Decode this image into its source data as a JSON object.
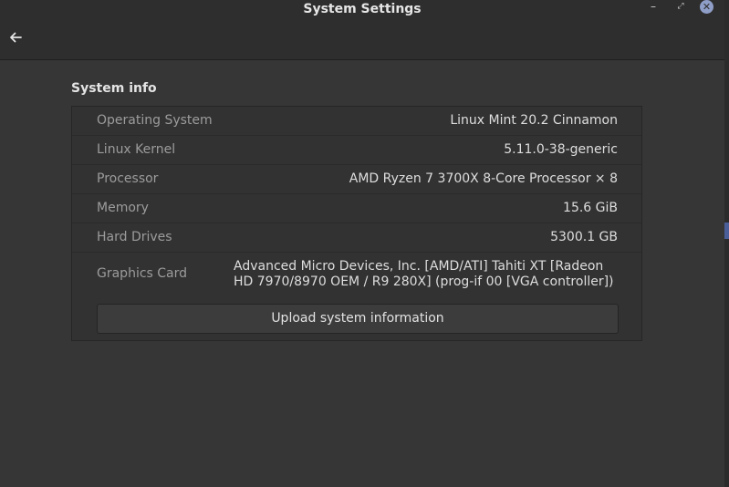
{
  "window": {
    "title": "System Settings",
    "controls": {
      "minimize": "–",
      "maximize": "⤢",
      "close": "✕"
    },
    "back_icon": "arrow-left-icon"
  },
  "section": {
    "title": "System info"
  },
  "rows": [
    {
      "label": "Operating System",
      "value": "Linux Mint 20.2 Cinnamon"
    },
    {
      "label": "Linux Kernel",
      "value": "5.11.0-38-generic"
    },
    {
      "label": "Processor",
      "value": "AMD Ryzen 7 3700X 8-Core Processor × 8"
    },
    {
      "label": "Memory",
      "value": "15.6 GiB"
    },
    {
      "label": "Hard Drives",
      "value": "5300.1 GB"
    },
    {
      "label": "Graphics Card",
      "value": "Advanced Micro Devices, Inc. [AMD/ATI] Tahiti XT [Radeon HD 7970/8970 OEM / R9 280X] (prog-if 00 [VGA controller])"
    }
  ],
  "upload_button": {
    "label": "Upload system information"
  },
  "colors": {
    "window_bg": "#363636",
    "titlebar_bg": "#2e2e2e",
    "panel_bg": "#323232",
    "label_text": "#9c9c9c",
    "value_text": "#dedede",
    "close_button": "#8f9ec7"
  }
}
